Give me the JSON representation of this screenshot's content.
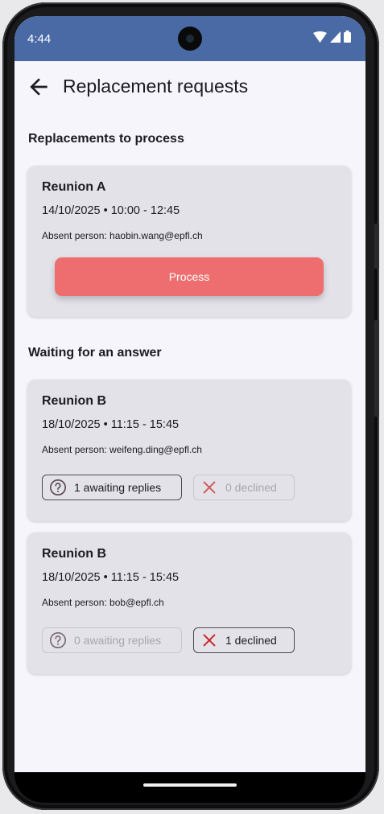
{
  "status_bar": {
    "time": "4:44"
  },
  "app_bar": {
    "title": "Replacement requests"
  },
  "sections": {
    "to_process": "Replacements to process",
    "waiting": "Waiting for an answer"
  },
  "to_process": [
    {
      "title": "Reunion A",
      "when": "14/10/2025 • 10:00 - 12:45",
      "absent": "Absent person: haobin.wang@epfl.ch",
      "action_label": "Process"
    }
  ],
  "waiting": [
    {
      "title": "Reunion B",
      "when": "18/10/2025 • 11:15 - 15:45",
      "absent": "Absent person: weifeng.ding@epfl.ch",
      "awaiting_label": "1 awaiting replies",
      "declined_label": "0 declined"
    },
    {
      "title": "Reunion B",
      "when": "18/10/2025 • 11:15 - 15:45",
      "absent": "Absent person: bob@epfl.ch",
      "awaiting_label": "0 awaiting replies",
      "declined_label": "1 declined"
    }
  ],
  "colors": {
    "status_bar": "#4a6aa5",
    "process_button": "#ee6e6f",
    "decline_icon": "#c62828"
  }
}
